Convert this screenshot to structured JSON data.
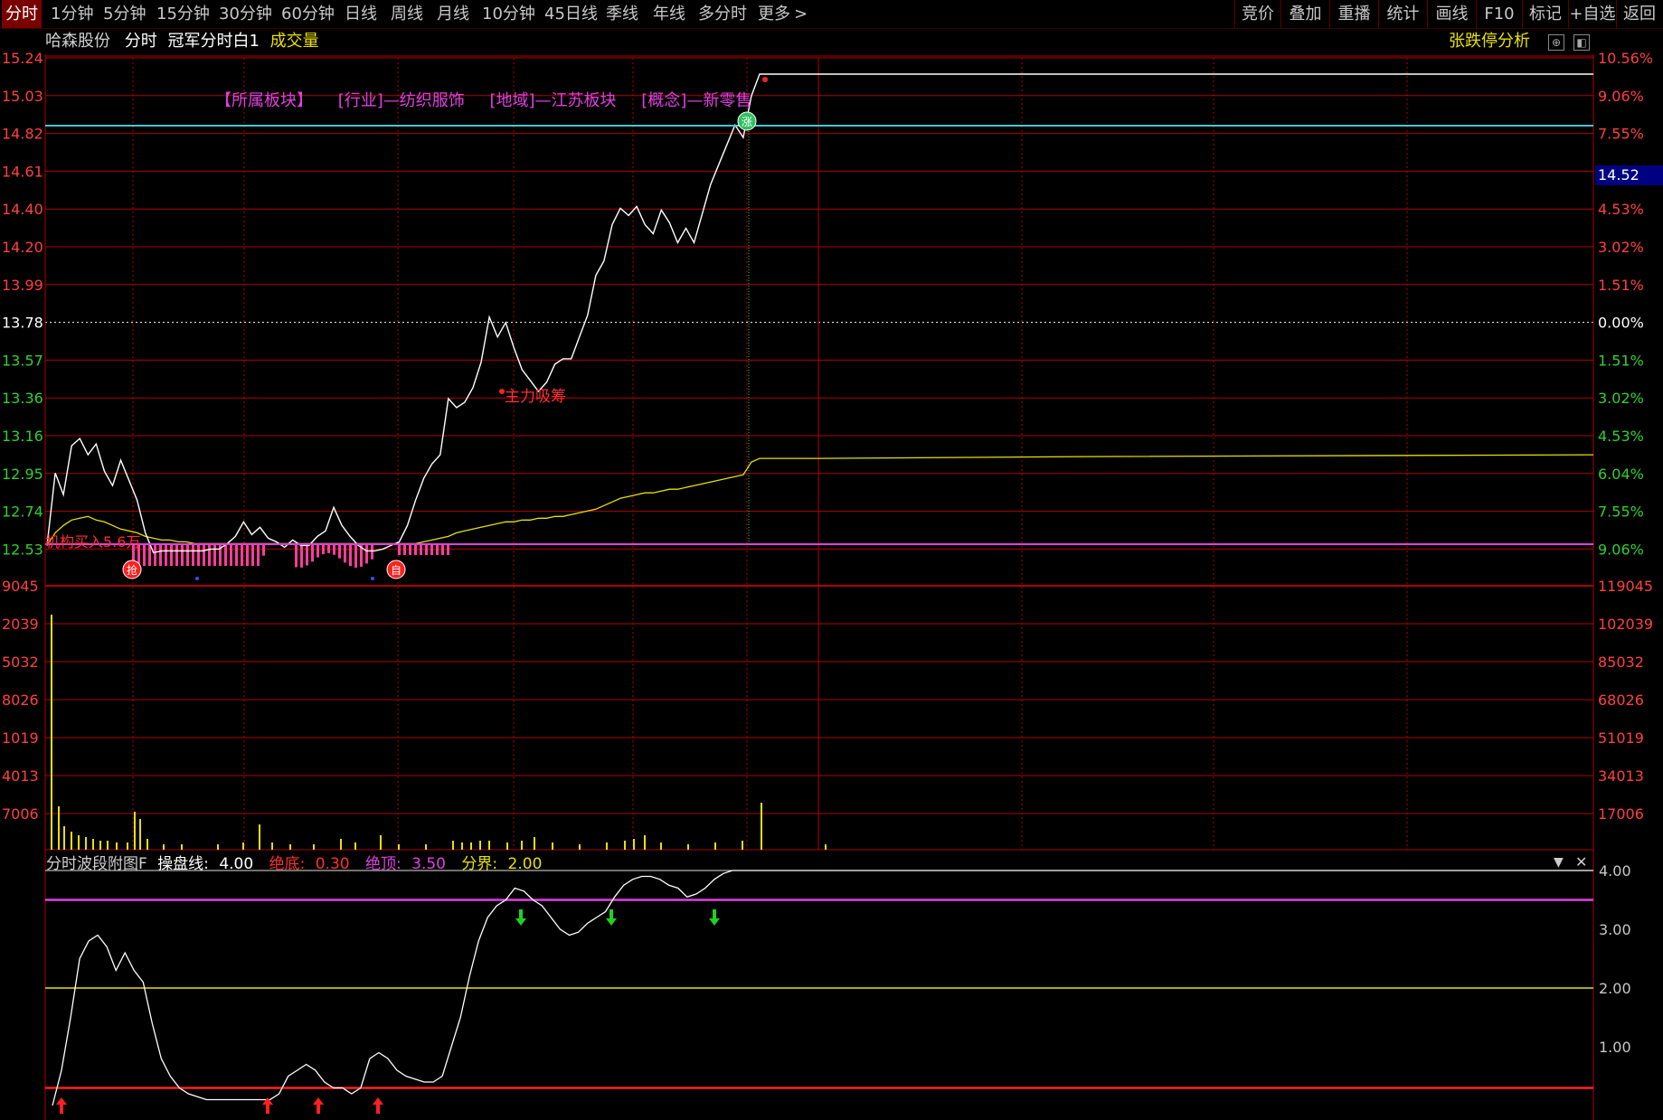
{
  "toolbar": {
    "periods": [
      "分时",
      "1分钟",
      "5分钟",
      "15分钟",
      "30分钟",
      "60分钟",
      "日线",
      "周线",
      "月线",
      "10分钟",
      "45日线",
      "季线",
      "年线",
      "多分时",
      "更多"
    ],
    "active": "分时",
    "right_buttons": [
      "竞价",
      "叠加",
      "重播",
      "统计",
      "画线",
      "F10",
      "标记",
      "+自选",
      "返回"
    ]
  },
  "info_bar": {
    "stock_name": "哈森股份",
    "view": "分时",
    "indicator": "冠军分时白1",
    "volume_label": "成交量",
    "limit_analysis": "张跌停分析"
  },
  "sector_tags": [
    "【所属板块】",
    "[行业]—纺织服饰",
    "[地域]—江苏板块",
    "[概念]—新零售"
  ],
  "price_axis": {
    "left": [
      "15.24",
      "15.03",
      "14.82",
      "14.61",
      "14.40",
      "14.20",
      "13.99",
      "13.78",
      "13.57",
      "13.36",
      "13.16",
      "12.95",
      "12.74",
      "12.53"
    ],
    "right": [
      "10.56%",
      "9.06%",
      "7.55%",
      "6.04%",
      "4.53%",
      "3.02%",
      "1.51%",
      "0.00%",
      "1.51%",
      "3.02%",
      "4.53%",
      "6.04%",
      "7.55%",
      "9.06%"
    ],
    "current_price": "14.52"
  },
  "volume_axis": {
    "left": [
      "9045",
      "2039",
      "5032",
      "8026",
      "1019",
      "4013",
      "7006"
    ],
    "right": [
      "119045",
      "102039",
      "85032",
      "68026",
      "51019",
      "34013",
      "17006"
    ]
  },
  "chart_annotations": {
    "institution_buy": "机构买入5.6万",
    "main_force": "主力吸筹",
    "badges": [
      "抢",
      "自",
      "涨"
    ]
  },
  "indicator_panel": {
    "name": "分时波段附图F",
    "line_label": "操盘线:",
    "line_value": "4.00",
    "bottom_label": "绝底:",
    "bottom_value": "0.30",
    "top_label": "绝顶:",
    "top_value": "3.50",
    "boundary_label": "分界:",
    "boundary_value": "2.00",
    "axis": [
      "4.00",
      "3.00",
      "2.00",
      "1.00"
    ],
    "controls": [
      "▼",
      "✕"
    ]
  },
  "colors": {
    "grid": "#b00000",
    "price_line": "#ffffff",
    "avg_line": "#e8e000",
    "limit_line": "#40c8d8",
    "magenta": "#e040e0",
    "pink_bars": "#ff3d9a",
    "axis_red": "#ff4040",
    "axis_green": "#30d030"
  },
  "price_series": [
    12.55,
    12.95,
    12.83,
    13.1,
    13.14,
    13.05,
    13.11,
    12.96,
    12.88,
    13.02,
    12.91,
    12.8,
    12.62,
    12.51,
    12.52,
    12.52,
    12.52,
    12.52,
    12.52,
    12.52,
    12.53,
    12.53,
    12.56,
    12.6,
    12.68,
    12.61,
    12.65,
    12.59,
    12.57,
    12.54,
    12.58,
    12.55,
    12.55,
    12.6,
    12.63,
    12.76,
    12.66,
    12.6,
    12.55,
    12.52,
    12.52,
    12.53,
    12.55,
    12.57,
    12.66,
    12.8,
    12.92,
    13.0,
    13.05,
    13.36,
    13.31,
    13.34,
    13.42,
    13.56,
    13.81,
    13.7,
    13.78,
    13.64,
    13.52,
    13.46,
    13.4,
    13.45,
    13.55,
    13.58,
    13.58,
    13.7,
    13.82,
    14.04,
    14.12,
    14.32,
    14.41,
    14.37,
    14.42,
    14.32,
    14.27,
    14.4,
    14.33,
    14.22,
    14.3,
    14.22,
    14.38,
    14.54,
    14.65,
    14.76,
    14.87,
    14.8,
    15.03,
    15.15
  ],
  "avg_series": [
    12.55,
    12.62,
    12.66,
    12.69,
    12.7,
    12.71,
    12.69,
    12.68,
    12.66,
    12.64,
    12.63,
    12.62,
    12.6,
    12.59,
    12.58,
    12.58,
    12.57,
    12.57,
    12.56,
    12.56,
    12.56,
    12.56,
    12.56,
    12.56,
    12.56,
    12.56,
    12.56,
    12.56,
    12.56,
    12.56,
    12.56,
    12.56,
    12.56,
    12.56,
    12.56,
    12.56,
    12.56,
    12.56,
    12.56,
    12.56,
    12.56,
    12.56,
    12.56,
    12.56,
    12.56,
    12.56,
    12.57,
    12.58,
    12.59,
    12.6,
    12.62,
    12.63,
    12.64,
    12.65,
    12.66,
    12.67,
    12.68,
    12.68,
    12.69,
    12.69,
    12.7,
    12.7,
    12.71,
    12.71,
    12.72,
    12.73,
    12.74,
    12.75,
    12.77,
    12.79,
    12.81,
    12.82,
    12.83,
    12.84,
    12.84,
    12.85,
    12.86,
    12.86,
    12.87,
    12.88,
    12.89,
    12.9,
    12.91,
    12.92,
    12.93,
    12.94,
    13.01,
    13.03
  ],
  "indicator_series": [
    0.0,
    0.6,
    1.5,
    2.5,
    2.8,
    2.9,
    2.7,
    2.3,
    2.6,
    2.3,
    2.1,
    1.4,
    0.8,
    0.5,
    0.3,
    0.2,
    0.15,
    0.1,
    0.1,
    0.1,
    0.1,
    0.1,
    0.1,
    0.1,
    0.1,
    0.2,
    0.5,
    0.6,
    0.7,
    0.6,
    0.4,
    0.3,
    0.3,
    0.2,
    0.3,
    0.8,
    0.9,
    0.8,
    0.6,
    0.5,
    0.45,
    0.4,
    0.4,
    0.5,
    1.0,
    1.5,
    2.2,
    2.8,
    3.2,
    3.4,
    3.5,
    3.7,
    3.65,
    3.5,
    3.4,
    3.2,
    3.0,
    2.9,
    2.95,
    3.1,
    3.2,
    3.3,
    3.55,
    3.75,
    3.85,
    3.9,
    3.9,
    3.85,
    3.75,
    3.7,
    3.55,
    3.6,
    3.7,
    3.85,
    3.95,
    4.0,
    4.0,
    4.0,
    4.0
  ]
}
